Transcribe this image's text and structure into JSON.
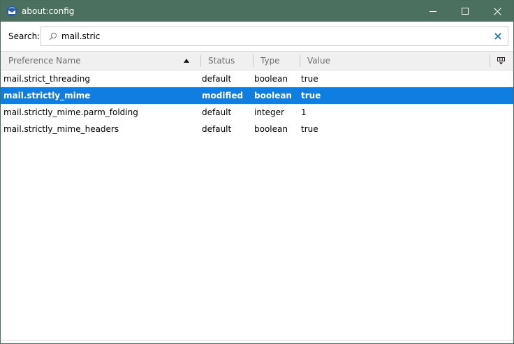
{
  "window": {
    "title": "about:config",
    "icon": "thunderbird-app-icon"
  },
  "search": {
    "label": "Search:",
    "value": "mail.stric",
    "placeholder": ""
  },
  "table": {
    "columns": {
      "name": "Preference Name",
      "status": "Status",
      "type": "Type",
      "value": "Value"
    },
    "sort": "name-ascending",
    "rows": [
      {
        "name": "mail.strict_threading",
        "status": "default",
        "type": "boolean",
        "value": "true"
      },
      {
        "name": "mail.strictly_mime",
        "status": "modified",
        "type": "boolean",
        "value": "true"
      },
      {
        "name": "mail.strictly_mime.parm_folding",
        "status": "default",
        "type": "integer",
        "value": "1"
      },
      {
        "name": "mail.strictly_mime_headers",
        "status": "default",
        "type": "boolean",
        "value": "true"
      }
    ],
    "selected_row": 1
  },
  "colors": {
    "titlebar": "#4b7060",
    "selection": "#0f7ee0",
    "clear_icon": "#1b6fa8"
  }
}
